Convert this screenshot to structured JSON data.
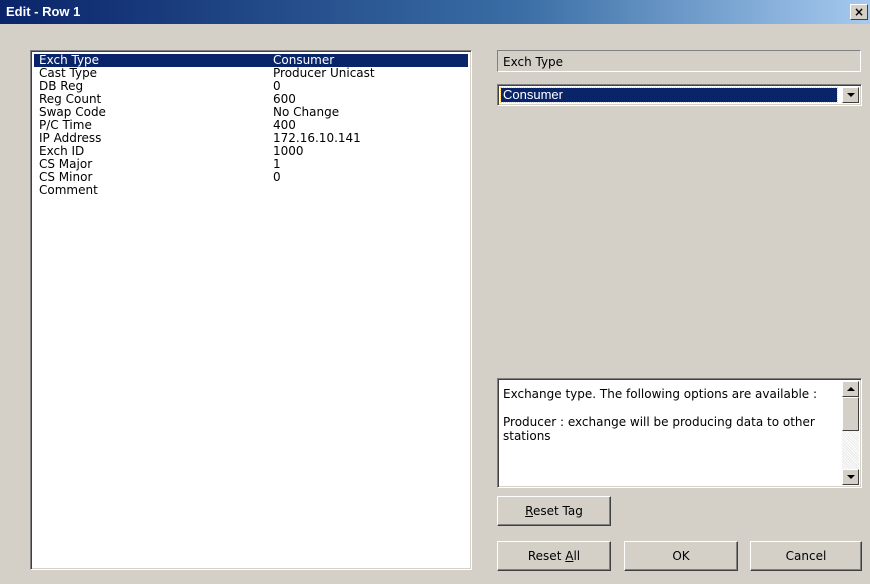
{
  "window": {
    "title": "Edit - Row 1",
    "close_glyph": "×"
  },
  "parameters": [
    {
      "name": "Exch Type",
      "value": "Consumer",
      "selected": true
    },
    {
      "name": "Cast Type",
      "value": "Producer Unicast",
      "selected": false
    },
    {
      "name": "DB Reg",
      "value": "0",
      "selected": false
    },
    {
      "name": "Reg Count",
      "value": "600",
      "selected": false
    },
    {
      "name": "Swap Code",
      "value": "No Change",
      "selected": false
    },
    {
      "name": "P/C Time",
      "value": "400",
      "selected": false
    },
    {
      "name": "IP Address",
      "value": "172.16.10.141",
      "selected": false
    },
    {
      "name": "Exch ID",
      "value": "1000",
      "selected": false
    },
    {
      "name": "CS Major",
      "value": "1",
      "selected": false
    },
    {
      "name": "CS Minor",
      "value": "0",
      "selected": false
    },
    {
      "name": "Comment",
      "value": "",
      "selected": false
    }
  ],
  "editor": {
    "field_label": "Exch Type",
    "selected_value": "Consumer",
    "help_text": "Exchange type. The following options are available :\n\nProducer : exchange will be producing data to other stations"
  },
  "buttons": {
    "reset_tag": {
      "prefix": "",
      "mnemonic": "R",
      "rest": "eset Tag"
    },
    "reset_all": {
      "prefix": "Reset ",
      "mnemonic": "A",
      "rest": "ll"
    },
    "ok": "OK",
    "cancel": "Cancel"
  },
  "colors": {
    "selection": "#0a246a",
    "dialog_bg": "#d4d0c8"
  }
}
